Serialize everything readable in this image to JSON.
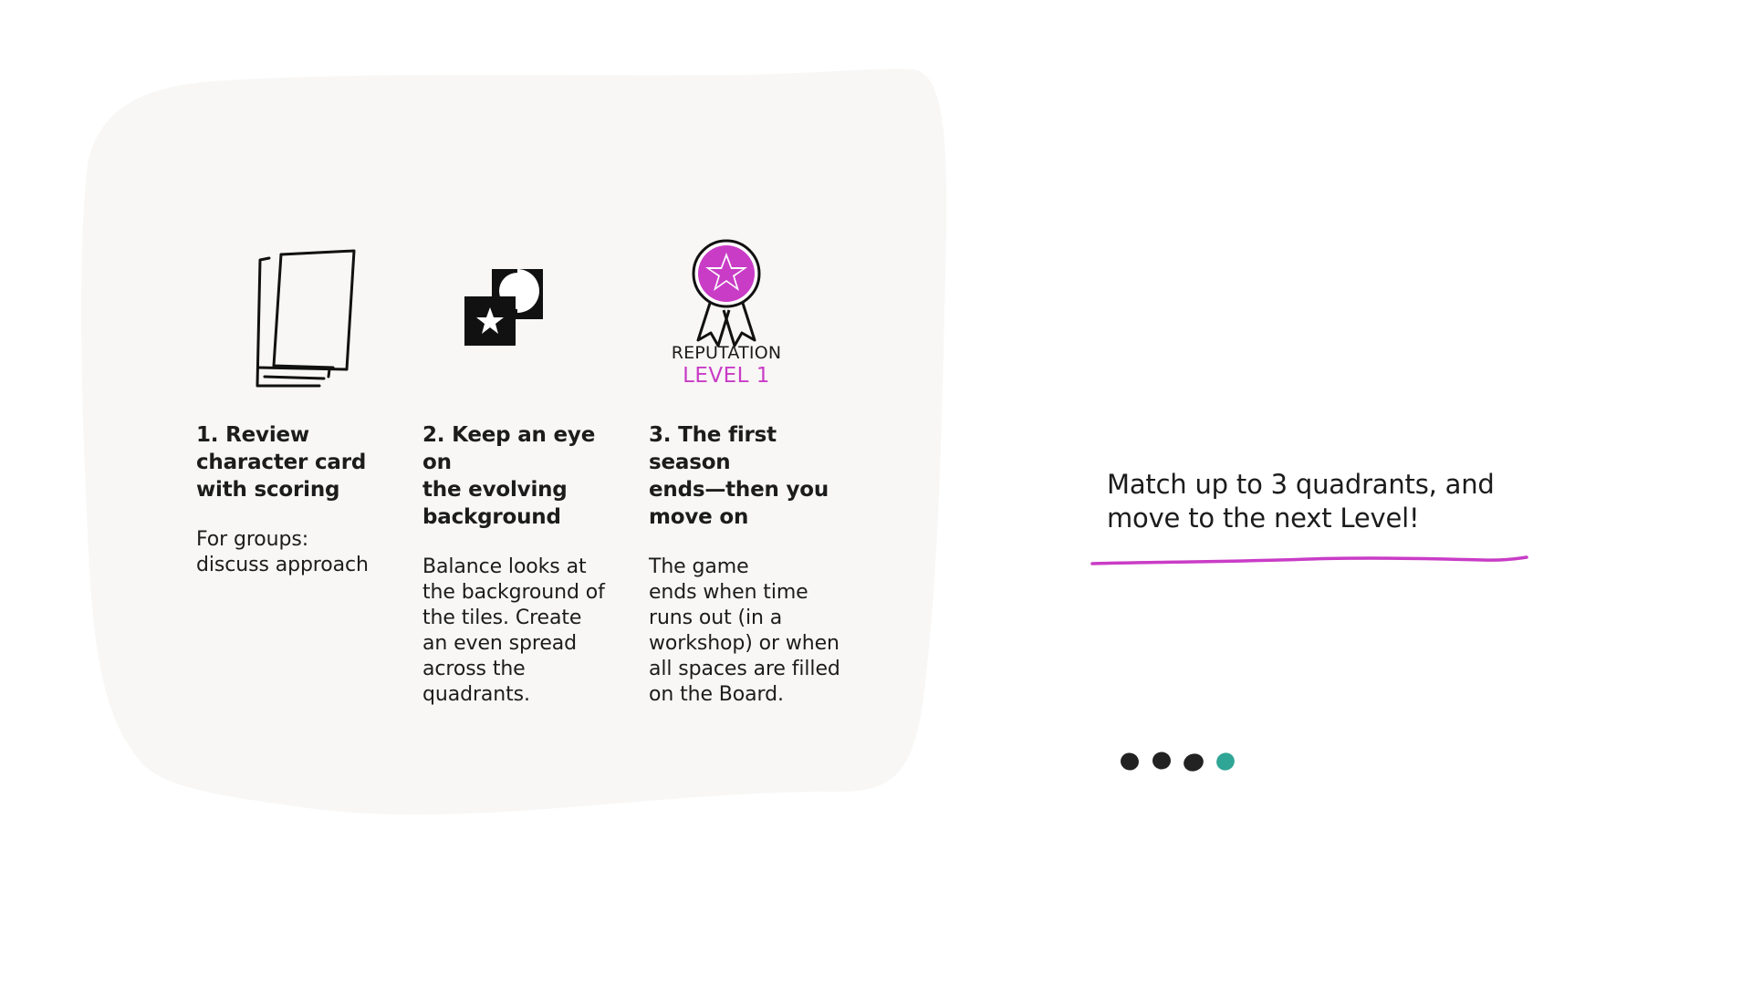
{
  "steps": [
    {
      "title": "1. Review\ncharacter card\nwith scoring",
      "body": "For groups:\ndiscuss approach",
      "icon": "stacked-cards-icon"
    },
    {
      "title": "2. Keep an eye on\nthe evolving\nbackground",
      "body": "Balance looks at\nthe background of\nthe tiles. Create\nan even spread\nacross the\nquadrants.",
      "icon": "quadrant-tiles-icon"
    },
    {
      "title": "3. The first season\nends—then you\nmove on",
      "body": "The game\nends when time\nruns out (in a\nworkshop) or when\nall spaces are filled\non the Board.",
      "icon": "reputation-ribbon-icon",
      "badge_label": "REPUTATION",
      "badge_level": "LEVEL 1"
    }
  ],
  "callout": {
    "text": "Match up to 3 quadrants, and\nmove to the next Level!"
  },
  "progress": {
    "total": 4,
    "current": 4
  },
  "colors": {
    "panel": "#f8f7f5",
    "accent": "#c93cc6",
    "text": "#1c1c1c",
    "dot": "#222222",
    "dot_active": "#2fa595"
  }
}
